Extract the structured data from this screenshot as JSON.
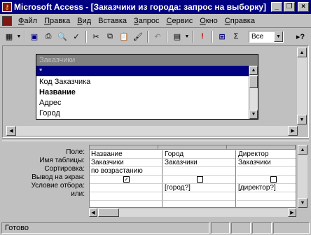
{
  "window": {
    "title": "Microsoft Access - [Заказчики из города: запрос на выборку]",
    "app_icon": "key-icon",
    "controls": [
      "minimize-icon",
      "restore-icon",
      "close-icon"
    ],
    "minimize_glyph": "_",
    "restore_glyph": "❐",
    "close_glyph": "×"
  },
  "menubar": {
    "items": [
      {
        "accel": "Ф",
        "rest": "айл"
      },
      {
        "accel": "П",
        "rest": "равка"
      },
      {
        "accel": "В",
        "rest": "ид"
      },
      {
        "accel": "",
        "rest": "Вставка"
      },
      {
        "accel": "З",
        "rest": "апрос"
      },
      {
        "accel": "С",
        "rest": "ервис"
      },
      {
        "accel": "О",
        "rest": "кно"
      },
      {
        "accel": "С",
        "rest": "правка"
      }
    ]
  },
  "toolbar": {
    "view_glyph": "▦",
    "save_glyph": "▣",
    "print_glyph": "⎙",
    "preview_glyph": "🔍",
    "spell_glyph": "✓",
    "cut_glyph": "✂",
    "copy_glyph": "⧉",
    "paste_glyph": "📋",
    "format_painter_glyph": "🖌",
    "undo_glyph": "↶",
    "query_type_glyph": "▤",
    "run_glyph": "!",
    "show_table_glyph": "⊞",
    "totals_glyph": "Σ",
    "top_values": "Все",
    "help_glyph": "▸?"
  },
  "field_list": {
    "title": "Заказчики",
    "fields": [
      {
        "label": "*",
        "selected": true,
        "bold": false
      },
      {
        "label": "Код Заказчика",
        "selected": false,
        "bold": false
      },
      {
        "label": "Название",
        "selected": false,
        "bold": true
      },
      {
        "label": "Адрес",
        "selected": false,
        "bold": false
      },
      {
        "label": "Город",
        "selected": false,
        "bold": false
      }
    ]
  },
  "grid": {
    "row_labels": [
      "Поле:",
      "Имя таблицы:",
      "Сортировка:",
      "Вывод на экран:",
      "Условие отбора:",
      "или:"
    ],
    "columns": [
      {
        "field": "Название",
        "table": "Заказчики",
        "sort": "по возрастанию",
        "show": true,
        "criteria": "",
        "or": ""
      },
      {
        "field": "Город",
        "table": "Заказчики",
        "sort": "",
        "show": false,
        "criteria": "[город?]",
        "or": ""
      },
      {
        "field": "Директор",
        "table": "Заказчики",
        "sort": "",
        "show": false,
        "criteria": "[директор?]",
        "or": ""
      }
    ],
    "check_glyph": "✓"
  },
  "status": {
    "text": "Готово"
  }
}
